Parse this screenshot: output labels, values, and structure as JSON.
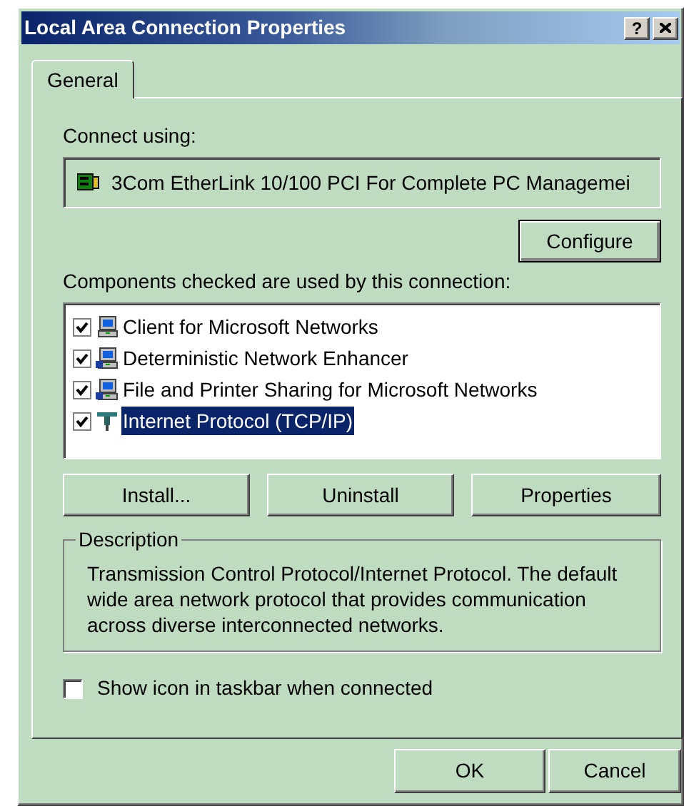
{
  "window": {
    "title": "Local Area Connection Properties",
    "title_buttons": [
      "?"
    ]
  },
  "tabs": [
    {
      "label": "General",
      "selected": true
    }
  ],
  "connect_using": {
    "label": "Connect using:",
    "adapter": "3Com EtherLink 10/100 PCI For Complete PC Managemei",
    "button": "Configure"
  },
  "components": {
    "label": "Components checked are used by this connection:",
    "items": [
      {
        "label": "Client for Microsoft Networks",
        "checked": true,
        "selected": false,
        "kind": "client"
      },
      {
        "label": "Deterministic Network Enhancer",
        "checked": true,
        "selected": false,
        "kind": "service"
      },
      {
        "label": "File and Printer Sharing for Microsoft Networks",
        "checked": true,
        "selected": false,
        "kind": "service"
      },
      {
        "label": "Internet Protocol (TCP/IP)",
        "checked": true,
        "selected": true,
        "kind": "protocol"
      }
    ]
  },
  "component_buttons": [
    "Install...",
    "Uninstall",
    "Properties"
  ],
  "description": {
    "title": "Description",
    "text": "Transmission Control Protocol/Internet Protocol. The default wide area network protocol that provides communication across diverse interconnected networks."
  },
  "show_icon": {
    "label": "Show icon in taskbar when connected",
    "checked": false
  },
  "buttons": [
    "OK",
    "Cancel"
  ]
}
